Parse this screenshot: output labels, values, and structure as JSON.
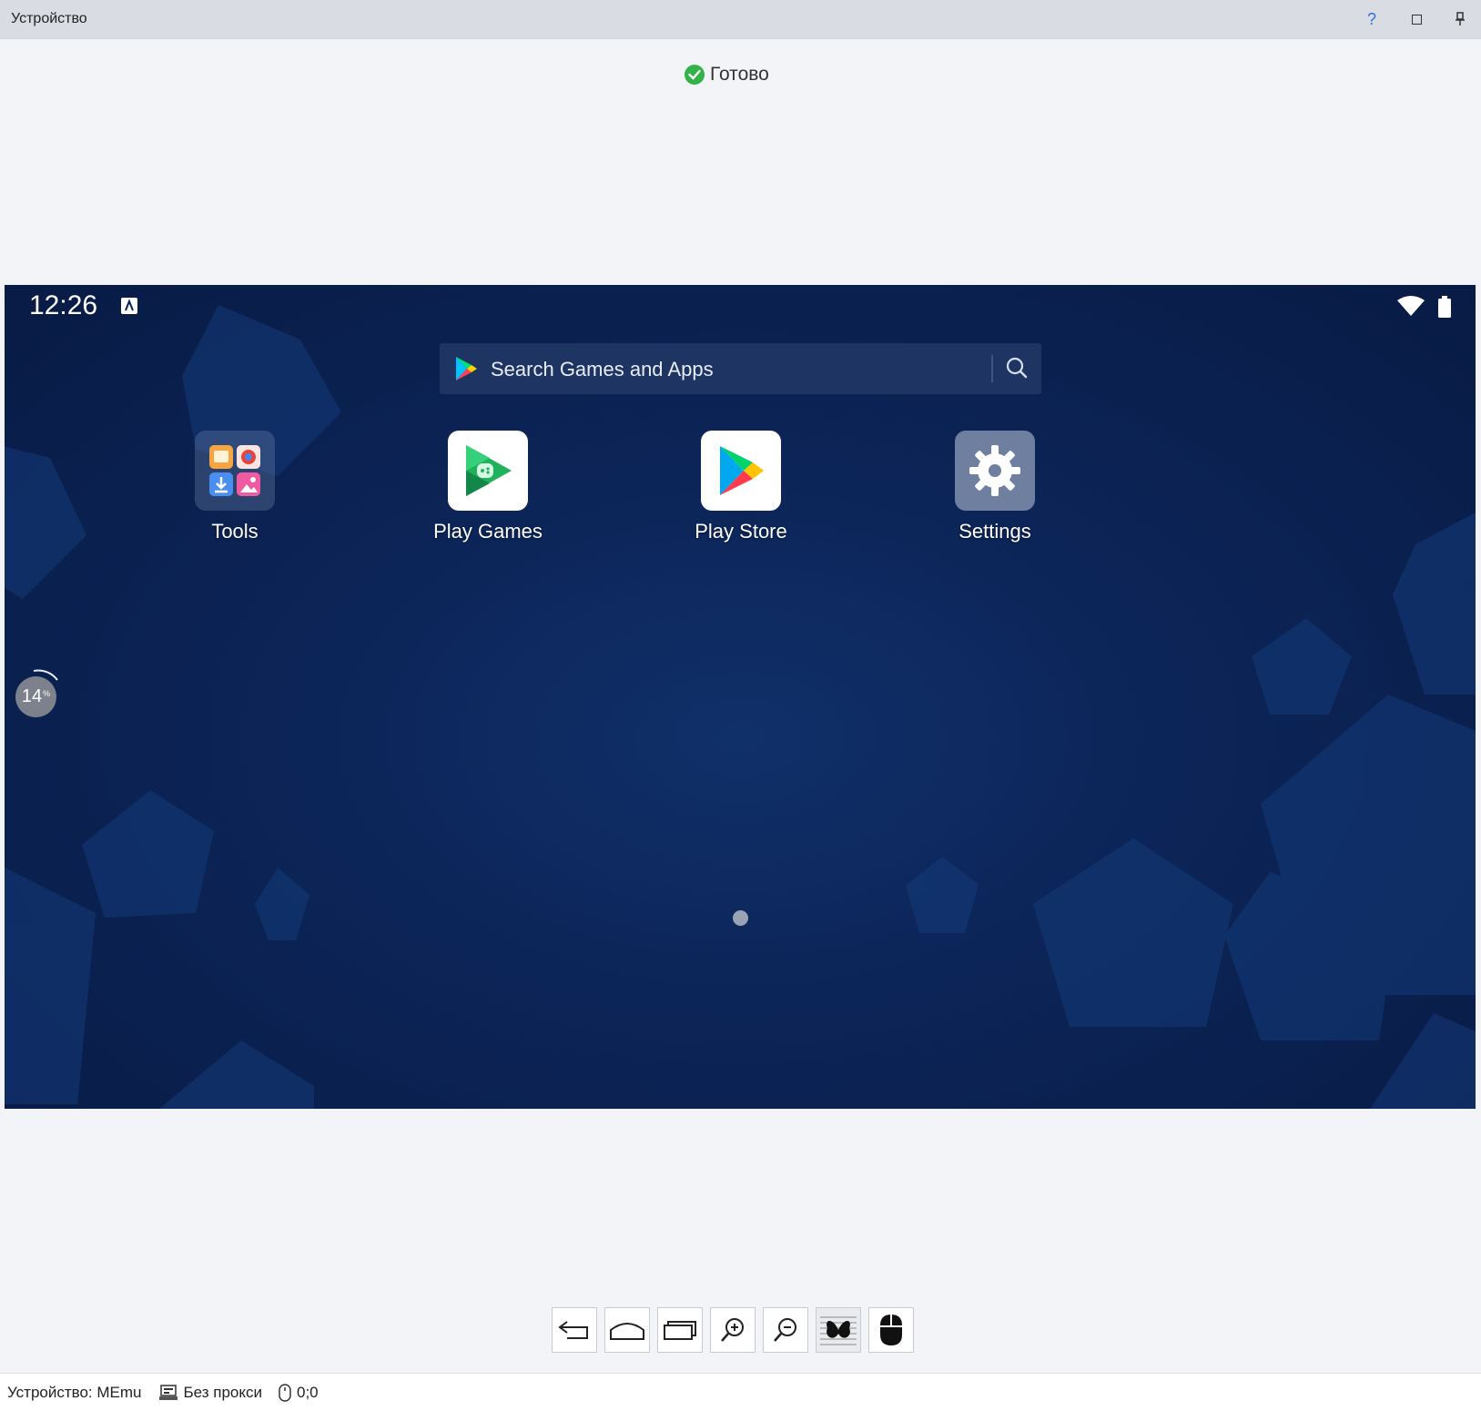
{
  "window": {
    "title": "Устройство",
    "help_glyph": "?"
  },
  "status": {
    "text": "Готово",
    "color": "#33b24a"
  },
  "device_screen": {
    "clock": "12:26",
    "search_placeholder": "Search Games and Apps",
    "apps": [
      {
        "label": "Tools",
        "icon": "tools-folder-icon"
      },
      {
        "label": "Play Games",
        "icon": "play-games-icon"
      },
      {
        "label": "Play Store",
        "icon": "play-store-icon"
      },
      {
        "label": "Settings",
        "icon": "settings-gear-icon"
      }
    ],
    "progress_value": "14",
    "progress_unit": "%"
  },
  "toolbar": {
    "buttons": [
      "back-icon",
      "home-icon",
      "recent-apps-icon",
      "zoom-in-icon",
      "zoom-out-icon",
      "butterfly-icon",
      "mouse-icon"
    ]
  },
  "statusbar": {
    "device": "Устройство: MEmu",
    "proxy": "Без прокси",
    "coords": "0;0"
  }
}
